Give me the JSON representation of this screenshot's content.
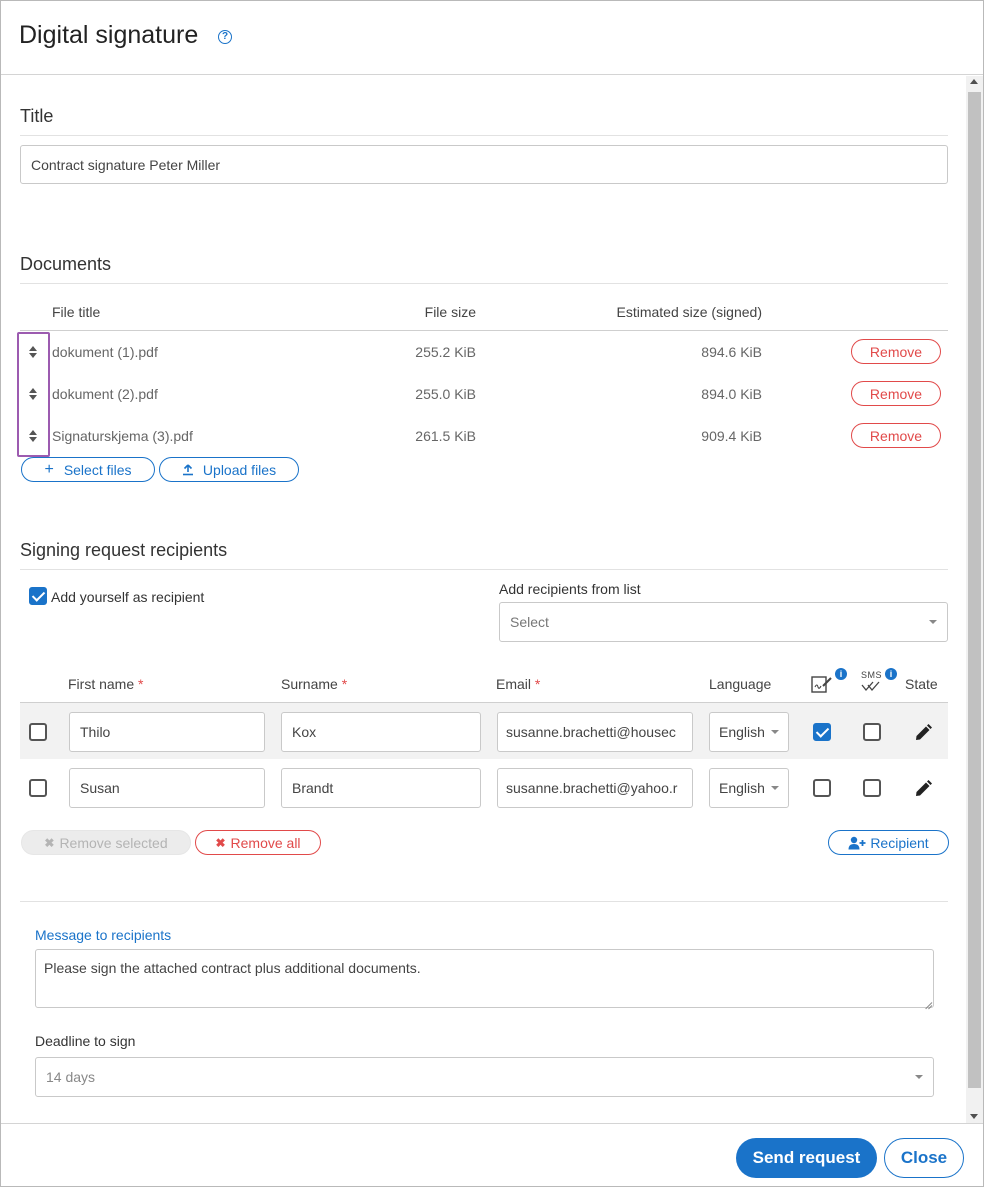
{
  "dialog": {
    "title": "Digital signature",
    "help_icon_glyph": "?"
  },
  "title_section": {
    "heading": "Title",
    "value": "Contract signature Peter Miller"
  },
  "documents": {
    "heading": "Documents",
    "columns": {
      "file_title": "File title",
      "file_size": "File size",
      "estimated_size": "Estimated size (signed)"
    },
    "rows": [
      {
        "title": "dokument (1).pdf",
        "size": "255.2 KiB",
        "estimated": "894.6 KiB",
        "remove_label": "Remove"
      },
      {
        "title": "dokument (2).pdf",
        "size": "255.0 KiB",
        "estimated": "894.0 KiB",
        "remove_label": "Remove"
      },
      {
        "title": "Signaturskjema (3).pdf",
        "size": "261.5 KiB",
        "estimated": "909.4 KiB",
        "remove_label": "Remove"
      }
    ],
    "select_files_label": "Select files",
    "upload_files_label": "Upload files"
  },
  "recipients": {
    "heading": "Signing request recipients",
    "add_yourself_label": "Add yourself as recipient",
    "add_yourself_checked": true,
    "from_list_label": "Add recipients from list",
    "from_list_placeholder": "Select",
    "columns": {
      "first_name": "First name",
      "surname": "Surname",
      "email": "Email",
      "language": "Language",
      "sms_icon_text": "SMS",
      "state": "State",
      "required_mark": "*",
      "info_glyph": "i"
    },
    "rows": [
      {
        "selected": false,
        "first_name": "Thilo",
        "surname": "Kox",
        "email": "susanne.brachetti@housec",
        "language": "English",
        "sign_checked": true,
        "sms_checked": false
      },
      {
        "selected": false,
        "first_name": "Susan",
        "surname": "Brandt",
        "email": "susanne.brachetti@yahoo.r",
        "language": "English",
        "sign_checked": false,
        "sms_checked": false
      }
    ],
    "remove_selected_label": "Remove selected",
    "remove_all_label": "Remove all",
    "add_recipient_label": "Recipient"
  },
  "message": {
    "label": "Message to recipients",
    "value": "Please sign the attached contract plus additional documents."
  },
  "deadline": {
    "label": "Deadline to sign",
    "value": "14 days"
  },
  "footer": {
    "send_label": "Send request",
    "close_label": "Close"
  },
  "colors": {
    "accent": "#1a73c9",
    "danger": "#e14a4a",
    "highlight": "#9c5bb0"
  }
}
